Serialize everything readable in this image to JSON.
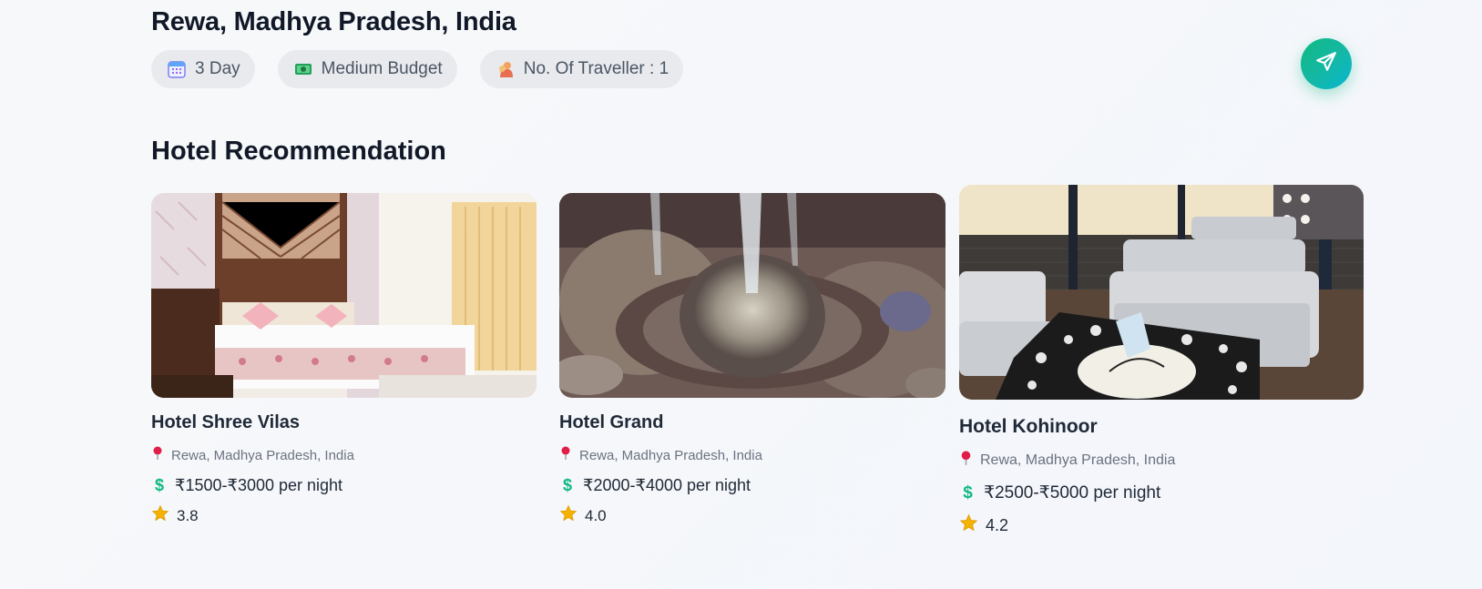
{
  "trip": {
    "title": "Rewa, Madhya Pradesh, India",
    "chips": [
      {
        "icon": "calendar-icon",
        "label": "3 Day"
      },
      {
        "icon": "money-icon",
        "label": "Medium Budget"
      },
      {
        "icon": "traveler-icon",
        "label": "No. Of Traveller : 1"
      }
    ]
  },
  "share_button": {
    "icon": "send-icon"
  },
  "section": {
    "title": "Hotel Recommendation"
  },
  "hotels": [
    {
      "name": "Hotel Shree Vilas",
      "location": "Rewa, Madhya Pradesh, India",
      "price": "₹1500-₹3000 per night",
      "rating": "3.8"
    },
    {
      "name": "Hotel Grand",
      "location": "Rewa, Madhya Pradesh, India",
      "price": "₹2000-₹4000 per night",
      "rating": "4.0"
    },
    {
      "name": "Hotel Kohinoor",
      "location": "Rewa, Madhya Pradesh, India",
      "price": "₹2500-₹5000 per night",
      "rating": "4.2"
    }
  ],
  "colors": {
    "accent": "#10b981",
    "accent_end": "#06b6d4",
    "star": "#f5b301",
    "pin": "#e11d48",
    "dollar": "#10b981"
  }
}
